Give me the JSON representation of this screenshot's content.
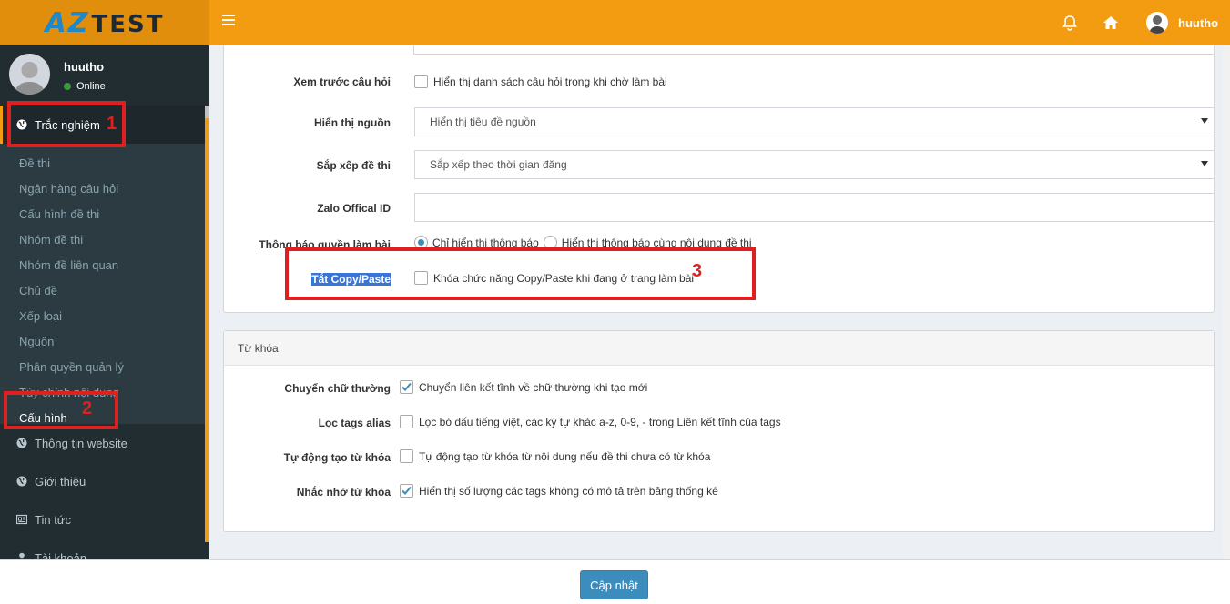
{
  "brand": {
    "logo_az": "AZ",
    "logo_text": "TEST"
  },
  "topbar": {
    "username": "huutho"
  },
  "sidebar": {
    "user": {
      "name": "huutho",
      "status": "Online"
    },
    "group_title": "Trắc nghiệm",
    "submenu": [
      "Đề thi",
      "Ngân hàng câu hỏi",
      "Cấu hình đề thi",
      "Nhóm đề thi",
      "Nhóm đề liên quan",
      "Chủ đề",
      "Xếp loại",
      "Nguồn",
      "Phân quyền quản lý",
      "Tùy chỉnh nội dung",
      "Cấu hình"
    ],
    "menu": [
      "Thông tin website",
      "Giới thiệu",
      "Tin tức",
      "Tài khoản"
    ]
  },
  "settings": {
    "preview": {
      "label": "Xem trước câu hỏi",
      "text": "Hiển thị danh sách câu hỏi trong khi chờ làm bài",
      "checked": false
    },
    "source_display": {
      "label": "Hiển thị nguồn",
      "value": "Hiển thị tiêu đề nguồn"
    },
    "sort_exam": {
      "label": "Sắp xếp đề thi",
      "value": "Sắp xếp theo thời gian đăng"
    },
    "zalo": {
      "label": "Zalo Offical ID",
      "value": ""
    },
    "permission_notice": {
      "label": "Thông báo quyền làm bài",
      "option1": "Chỉ hiển thị thông báo",
      "option2": "Hiển thị thông báo cùng nội dung đề thi"
    },
    "copy_paste": {
      "label": "Tắt Copy/Paste",
      "text": "Khóa chức năng Copy/Paste khi đang ở trang làm bài",
      "checked": false
    }
  },
  "keywords": {
    "title": "Từ khóa",
    "lowercase": {
      "label": "Chuyển chữ thường",
      "text": "Chuyển liên kết tĩnh về chữ thường khi tạo mới",
      "checked": true
    },
    "filter_tags": {
      "label": "Lọc tags alias",
      "text": "Lọc bỏ dấu tiếng việt, các ký tự khác a-z, 0-9, - trong Liên kết tĩnh của tags",
      "checked": false
    },
    "auto_create": {
      "label": "Tự động tạo từ khóa",
      "text": "Tự động tạo từ khóa từ nội dung nếu đề thi chưa có từ khóa",
      "checked": false
    },
    "reminder": {
      "label": "Nhắc nhở từ khóa",
      "text": "Hiển thị số lượng các tags không có mô tả trên bảng thống kê",
      "checked": true
    }
  },
  "annotations": {
    "n1": "1",
    "n2": "2",
    "n3": "3"
  },
  "footer": {
    "update_label": "Cập nhật"
  },
  "colors": {
    "accent": "#f39c12",
    "sidebar": "#222d32",
    "primary": "#3c8dbc",
    "annotation": "#e02020"
  }
}
